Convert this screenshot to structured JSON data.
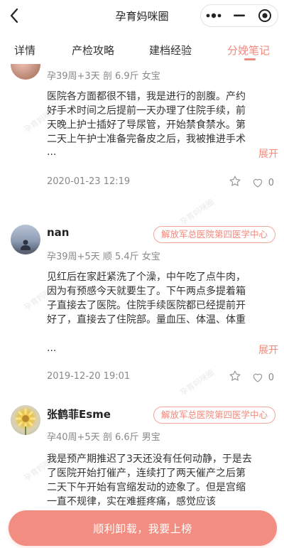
{
  "navbar": {
    "title": "孕育妈咪圈"
  },
  "tabs": [
    "详情",
    "产检攻略",
    "建档经验",
    "分娩笔记"
  ],
  "watermark": "孕育妈咪圈",
  "posts": [
    {
      "username": "",
      "hospital": "",
      "meta": "孕39周+3天  剖  6.9斤  女宝",
      "body": "医院各方面都很不错，我是进行的剖腹。产约好手术时间之后提前一天办理了住院手续，前天晚上护士插好了导尿管，开始禁食禁水。第二天上午护士准备完备皮之后，我被推进手术",
      "ellipsis": "...",
      "expand": "展开",
      "date": "2020-01-23 12:19",
      "likes": "0"
    },
    {
      "username": "nan",
      "hospital": "解放军总医院第四医学中心",
      "meta": "孕39周+5天  顺  5.4斤  女宝",
      "body": "见红后在家赶紧洗了个澡，中午吃了点牛肉，因为有预感今天就要生了。下午两点多提着箱子直接去了医院。住院手续医院都已经提前开好了，直接去了住院部。量血压、体温、体重",
      "ellipsis": "...",
      "expand": "展开",
      "date": "2019-12-20 19:01",
      "likes": "0"
    },
    {
      "username": "张鹤菲Esme",
      "hospital": "解放军总医院第四医学中心",
      "meta": "孕40周+5天  剖  6.6斤  男宝",
      "body": "我是预产期推迟了3天还没有任何动静，于是去了医院开始打催产，连续打了两天催产之后第二天下午开始有宫缩发动的迹象了。但是宫缩一直不规律，实在难捱疼痛，感觉应该",
      "ellipsis": "",
      "expand": "",
      "date": "",
      "likes": ""
    }
  ],
  "bottom_button": "顺利卸载，我要上榜",
  "colors": {
    "accent": "#f08a7e",
    "button": "#f28e81",
    "meta": "#888888"
  }
}
